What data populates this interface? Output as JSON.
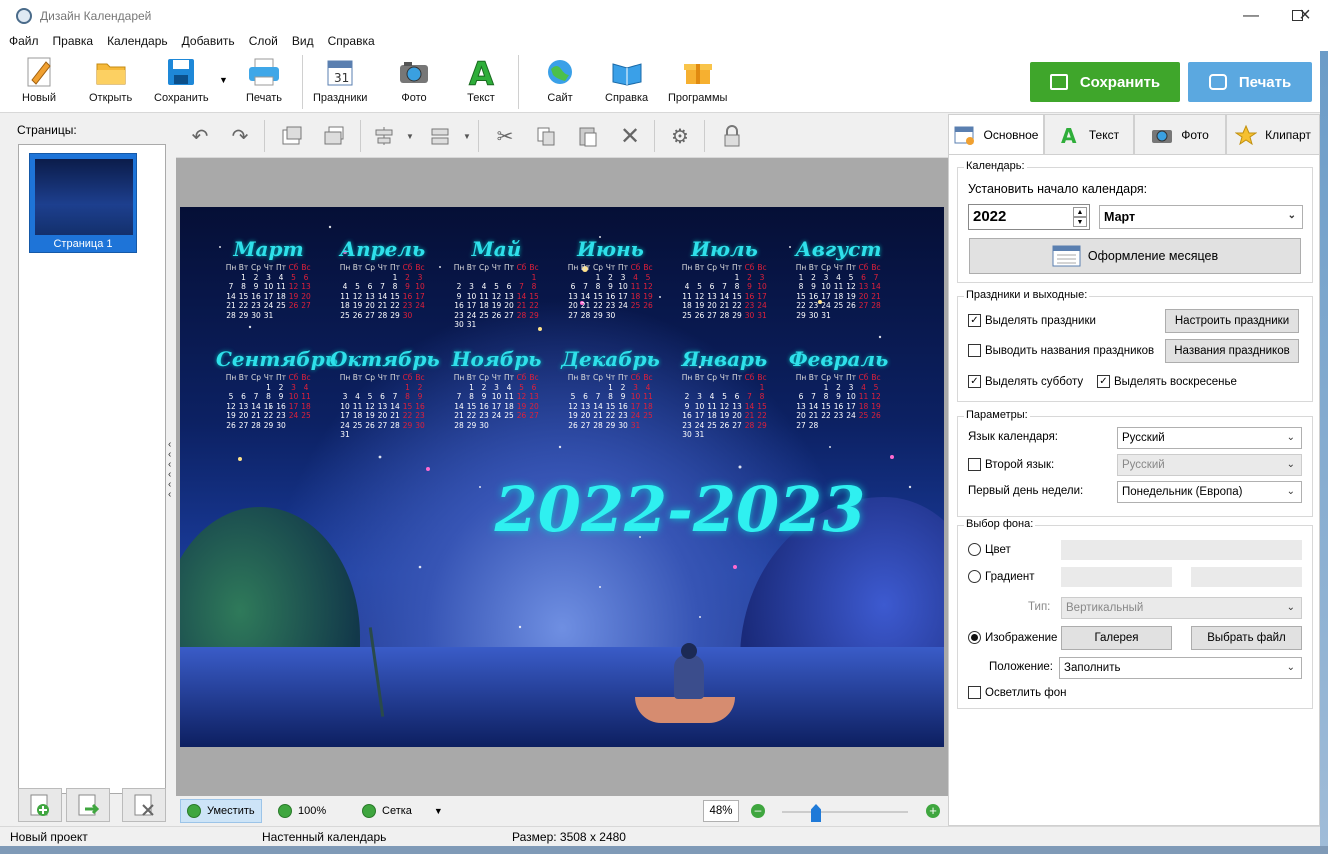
{
  "window": {
    "title": "Дизайн Календарей"
  },
  "menu": [
    "Файл",
    "Правка",
    "Календарь",
    "Добавить",
    "Слой",
    "Вид",
    "Справка"
  ],
  "toolbar": {
    "new": "Новый",
    "open": "Открыть",
    "save": "Сохранить",
    "print": "Печать",
    "holidays": "Праздники",
    "photo": "Фото",
    "text": "Текст",
    "site": "Сайт",
    "help": "Справка",
    "programs": "Программы",
    "save_big": "Сохранить",
    "print_big": "Печать"
  },
  "left": {
    "pages_label": "Страницы:",
    "page1": "Страница 1"
  },
  "calendar": {
    "year_text": "2022-2023",
    "weekdays": [
      "Пн",
      "Вт",
      "Ср",
      "Чт",
      "Пт",
      "Сб",
      "Вс"
    ],
    "months": [
      {
        "name": "Март",
        "start": 1,
        "days": 31
      },
      {
        "name": "Апрель",
        "start": 4,
        "days": 30
      },
      {
        "name": "Май",
        "start": 6,
        "days": 31
      },
      {
        "name": "Июнь",
        "start": 2,
        "days": 30
      },
      {
        "name": "Июль",
        "start": 4,
        "days": 31
      },
      {
        "name": "Август",
        "start": 0,
        "days": 31
      },
      {
        "name": "Сентябрь",
        "start": 3,
        "days": 30
      },
      {
        "name": "Октябрь",
        "start": 5,
        "days": 31
      },
      {
        "name": "Ноябрь",
        "start": 1,
        "days": 30
      },
      {
        "name": "Декабрь",
        "start": 3,
        "days": 31
      },
      {
        "name": "Январь",
        "start": 6,
        "days": 31
      },
      {
        "name": "Февраль",
        "start": 2,
        "days": 28
      }
    ]
  },
  "bottombar": {
    "fit": "Уместить",
    "hundred": "100%",
    "grid": "Сетка",
    "zoom": "48%"
  },
  "right": {
    "tabs": [
      "Основное",
      "Текст",
      "Фото",
      "Клипарт"
    ],
    "calendar_group": "Календарь:",
    "start_label": "Установить начало календаря:",
    "year": "2022",
    "month": "Март",
    "months_design": "Оформление месяцев",
    "holidays_group": "Праздники и выходные:",
    "highlight_holidays": "Выделять праздники",
    "setup_holidays": "Настроить праздники",
    "show_names": "Выводить названия праздников",
    "holiday_names": "Названия праздников",
    "highlight_sat": "Выделять субботу",
    "highlight_sun": "Выделять воскресенье",
    "params_group": "Параметры:",
    "lang_label": "Язык календаря:",
    "lang": "Русский",
    "second_lang_label": "Второй язык:",
    "second_lang": "Русский",
    "first_day_label": "Первый день недели:",
    "first_day": "Понедельник (Европа)",
    "bg_group": "Выбор фона:",
    "color": "Цвет",
    "gradient": "Градиент",
    "type_label": "Тип:",
    "type": "Вертикальный",
    "image": "Изображение",
    "gallery": "Галерея",
    "choose_file": "Выбрать файл",
    "position_label": "Положение:",
    "position": "Заполнить",
    "lighten": "Осветлить фон"
  },
  "status": {
    "project": "Новый проект",
    "type": "Настенный календарь",
    "size": "Размер: 3508 x 2480"
  },
  "colors": {
    "green": "#3fa62b",
    "blue": "#5ba8e0",
    "accent": "#2fe0ea"
  }
}
